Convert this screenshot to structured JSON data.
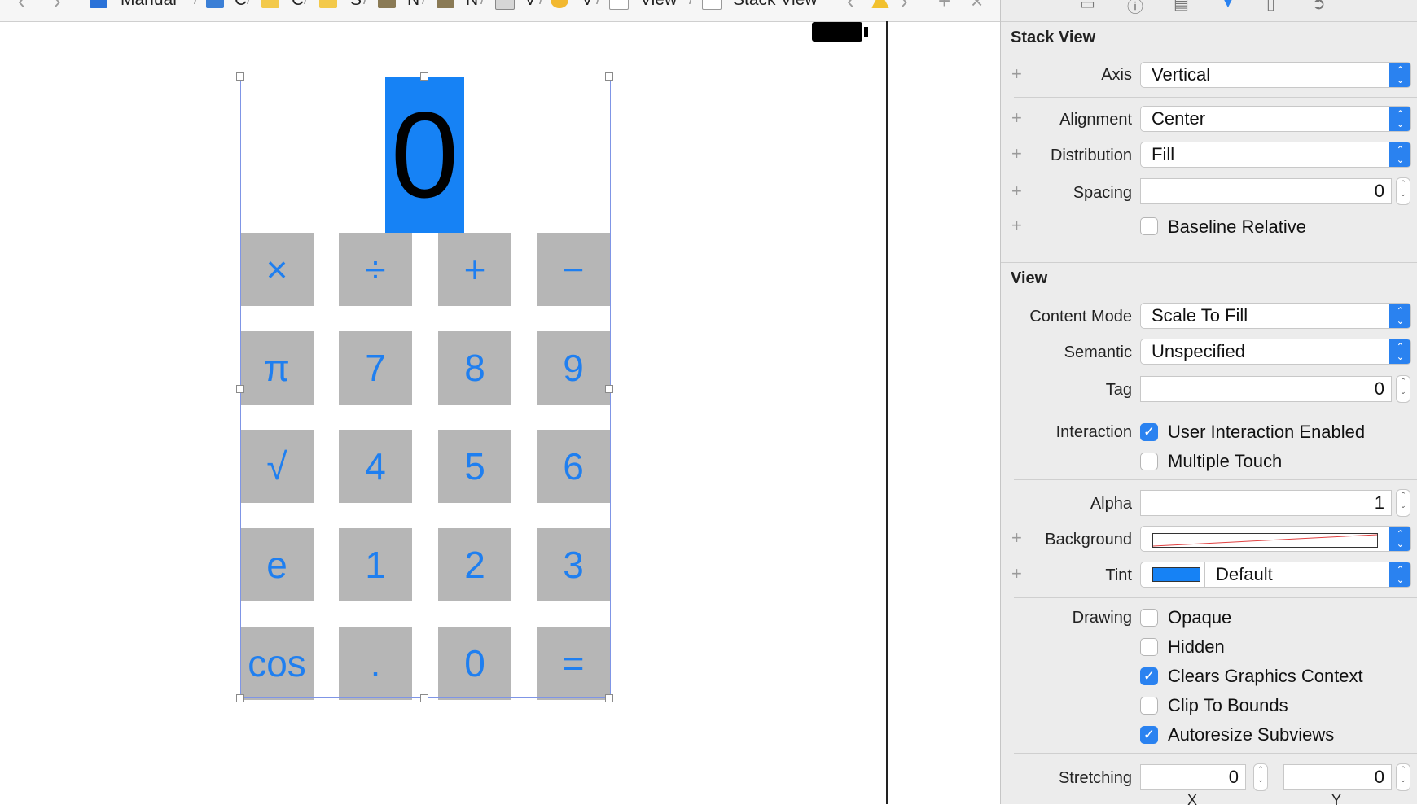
{
  "jumpbar": {
    "items": [
      "Manual",
      "C",
      "C",
      "S",
      "N",
      "N",
      "V",
      "V",
      "View",
      "Stack View"
    ]
  },
  "calculator": {
    "display": "0",
    "keys": [
      [
        "×",
        "÷",
        "+",
        "−"
      ],
      [
        "π",
        "7",
        "8",
        "9"
      ],
      [
        "√",
        "4",
        "5",
        "6"
      ],
      [
        "e",
        "1",
        "2",
        "3"
      ],
      [
        "cos",
        ".",
        "0",
        "="
      ]
    ]
  },
  "inspector": {
    "stack_view": {
      "title": "Stack View",
      "axis_label": "Axis",
      "axis_value": "Vertical",
      "alignment_label": "Alignment",
      "alignment_value": "Center",
      "distribution_label": "Distribution",
      "distribution_value": "Fill",
      "spacing_label": "Spacing",
      "spacing_value": "0",
      "baseline_label": "Baseline Relative",
      "baseline_checked": false
    },
    "view": {
      "title": "View",
      "content_mode_label": "Content Mode",
      "content_mode_value": "Scale To Fill",
      "semantic_label": "Semantic",
      "semantic_value": "Unspecified",
      "tag_label": "Tag",
      "tag_value": "0",
      "interaction_label": "Interaction",
      "user_interaction_label": "User Interaction Enabled",
      "user_interaction_checked": true,
      "multiple_touch_label": "Multiple Touch",
      "multiple_touch_checked": false,
      "alpha_label": "Alpha",
      "alpha_value": "1",
      "background_label": "Background",
      "tint_label": "Tint",
      "tint_value": "Default",
      "tint_color": "#1682f5",
      "drawing_label": "Drawing",
      "opaque_label": "Opaque",
      "opaque_checked": false,
      "hidden_label": "Hidden",
      "hidden_checked": false,
      "clears_label": "Clears Graphics Context",
      "clears_checked": true,
      "clip_label": "Clip To Bounds",
      "clip_checked": false,
      "autoresize_label": "Autoresize Subviews",
      "autoresize_checked": true,
      "stretching_label": "Stretching",
      "stretch_x_value": "0",
      "stretch_y_value": "0",
      "x_label": "X",
      "y_label": "Y"
    }
  },
  "colors": {
    "accent": "#2a82f0",
    "key_bg": "#b6b6b6",
    "key_text": "#1f7ff0",
    "display_bg": "#1682f5"
  }
}
